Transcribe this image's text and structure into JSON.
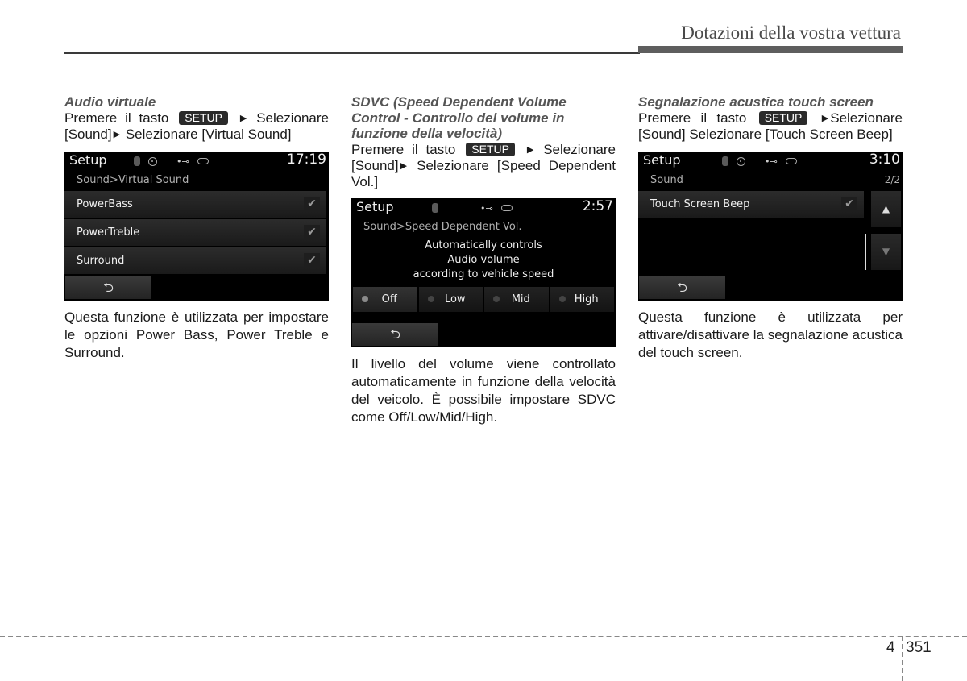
{
  "header": {
    "title": "Dotazioni della vostra vettura"
  },
  "sections": [
    {
      "title": "Audio virtuale",
      "instruction": {
        "pre": "Premere il tasto",
        "key": "SETUP",
        "arrow": "▶",
        "step1": "Selezionare",
        "step2_pre": "[Sound]",
        "step2": "Selezionare [Virtual Sound]"
      },
      "screen": {
        "title": "Setup",
        "time": "17:19",
        "breadcrumb": "Sound>Virtual Sound",
        "items": [
          {
            "label": "PowerBass",
            "checked": true
          },
          {
            "label": "PowerTreble",
            "checked": true
          },
          {
            "label": "Surround",
            "checked": true
          }
        ],
        "back_icon": "back-arrow-icon"
      },
      "description": "Questa funzione è utilizzata per impostare le opzioni Power Bass, Power Treble e Surround."
    },
    {
      "title": "SDVC (Speed Dependent Volume Control - Controllo del volume in funzione della velocità)",
      "instruction": {
        "pre": "Premere il tasto",
        "key": "SETUP",
        "arrow": "▶",
        "step1": "Selezionare",
        "step2_pre": "[Sound]",
        "step2": "Selezionare [Speed Dependent Vol.]"
      },
      "screen": {
        "title": "Setup",
        "time": "2:57",
        "breadcrumb": "Sound>Speed Dependent Vol.",
        "message": [
          "Automatically controls",
          "Audio volume",
          "according to vehicle speed"
        ],
        "options": [
          "Off",
          "Low",
          "Mid",
          "High"
        ],
        "selected": "Off"
      },
      "description": "Il livello del volume viene controllato automaticamente in funzione della velocità del veicolo. È possibile impostare SDVC come Off/Low/Mid/High."
    },
    {
      "title": "Segnalazione acustica touch screen",
      "instruction": {
        "pre": "Premere il tasto",
        "key": "SETUP",
        "arrow": "▶",
        "step1": "Selezionare",
        "step2_pre": "[Sound]",
        "step2": "Selezionare [Touch Screen Beep]"
      },
      "screen": {
        "title": "Setup",
        "time": "3:10",
        "breadcrumb": "Sound",
        "page": "2/2",
        "items": [
          {
            "label": "Touch Screen Beep",
            "checked": true
          }
        ]
      },
      "description": "Questa funzione è utilizzata per attivare/disattivare la segnalazione acustica del touch screen."
    }
  ],
  "footer": {
    "chapter": "4",
    "page": "351"
  },
  "glyphs": {
    "check": "✔",
    "back": "⮌",
    "up": "▲",
    "down": "▼",
    "usb": "⇠⊶",
    "bt": "ʙ"
  }
}
